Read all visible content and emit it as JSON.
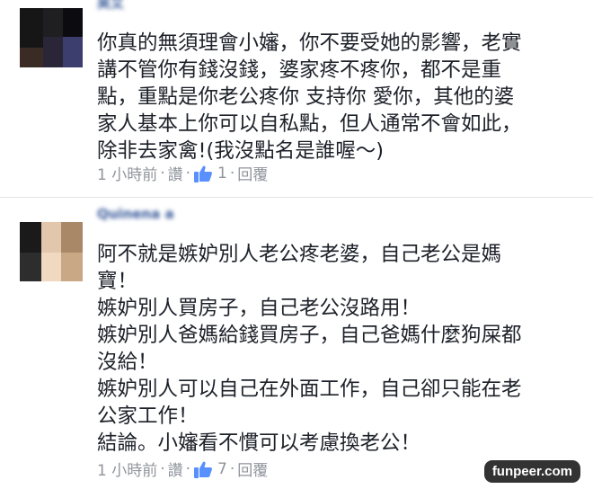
{
  "comments": [
    {
      "author": "吴艾",
      "lines": [
        "你真的無須理會小嬸，你不要受她的影響，老實",
        "講不管你有錢沒錢，婆家疼不疼你，都不是重",
        "點，重點是你老公疼你 支持你 愛你，其他的婆",
        "家人基本上你可以自私點，但人通常不會如此，",
        "除非去家禽!(我沒點名是誰喔～)"
      ],
      "time": "1 小時前",
      "like_label": "讚",
      "like_count": "1",
      "reply_label": "回覆"
    },
    {
      "author": "Quinena a",
      "lines": [
        "阿不就是嫉妒別人老公疼老婆，自己老公是媽",
        "寶！",
        "嫉妒別人買房子，自己老公沒路用！",
        "嫉妒別人爸媽給錢買房子，自己爸媽什麼狗屎都",
        "沒給！",
        "嫉妒別人可以自己在外面工作，自己卻只能在老",
        "公家工作！",
        "結論。小嬸看不慣可以考慮換老公！"
      ],
      "time": "1 小時前",
      "like_label": "讚",
      "like_count": "7",
      "reply_label": "回覆"
    }
  ],
  "separator": "·",
  "watermark": "funpeer.com",
  "colors": {
    "text": "#1d2129",
    "meta": "#90949c",
    "like_blue": "#5890ff",
    "name": "#365899"
  }
}
